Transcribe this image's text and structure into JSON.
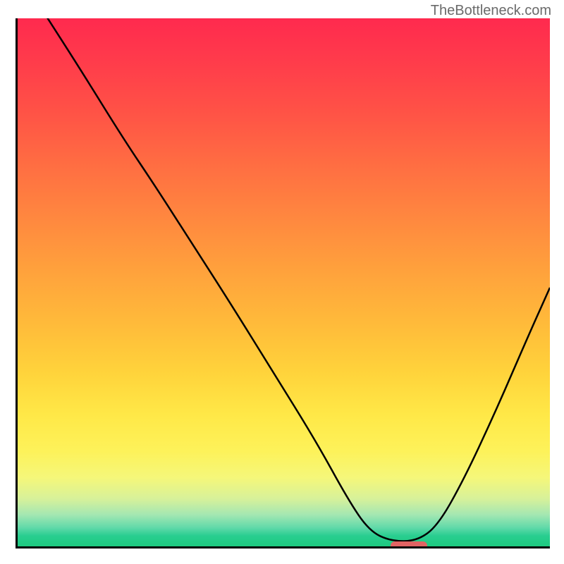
{
  "watermark": "TheBottleneck.com",
  "chart_data": {
    "type": "line",
    "title": "",
    "xlabel": "",
    "ylabel": "",
    "x_range": [
      0,
      100
    ],
    "y_range": [
      0,
      100
    ],
    "gradient_meaning": "bottleneck severity (red=high, green=low)",
    "curve_points": [
      {
        "x": 5,
        "y": 101
      },
      {
        "x": 12,
        "y": 90
      },
      {
        "x": 20,
        "y": 77
      },
      {
        "x": 26,
        "y": 68
      },
      {
        "x": 33,
        "y": 57
      },
      {
        "x": 40,
        "y": 46
      },
      {
        "x": 48,
        "y": 33
      },
      {
        "x": 56,
        "y": 20
      },
      {
        "x": 62,
        "y": 9
      },
      {
        "x": 66,
        "y": 3
      },
      {
        "x": 70,
        "y": 1
      },
      {
        "x": 75,
        "y": 1
      },
      {
        "x": 79,
        "y": 4
      },
      {
        "x": 84,
        "y": 13
      },
      {
        "x": 90,
        "y": 26
      },
      {
        "x": 96,
        "y": 40
      },
      {
        "x": 100,
        "y": 49
      }
    ],
    "optimum_range_x": [
      70,
      77
    ],
    "optimum_marker_color": "#e16363"
  },
  "colors": {
    "axis": "#000000",
    "curve": "#000000",
    "gradient_top": "#ff2a4e",
    "gradient_bottom": "#1ec97f"
  }
}
